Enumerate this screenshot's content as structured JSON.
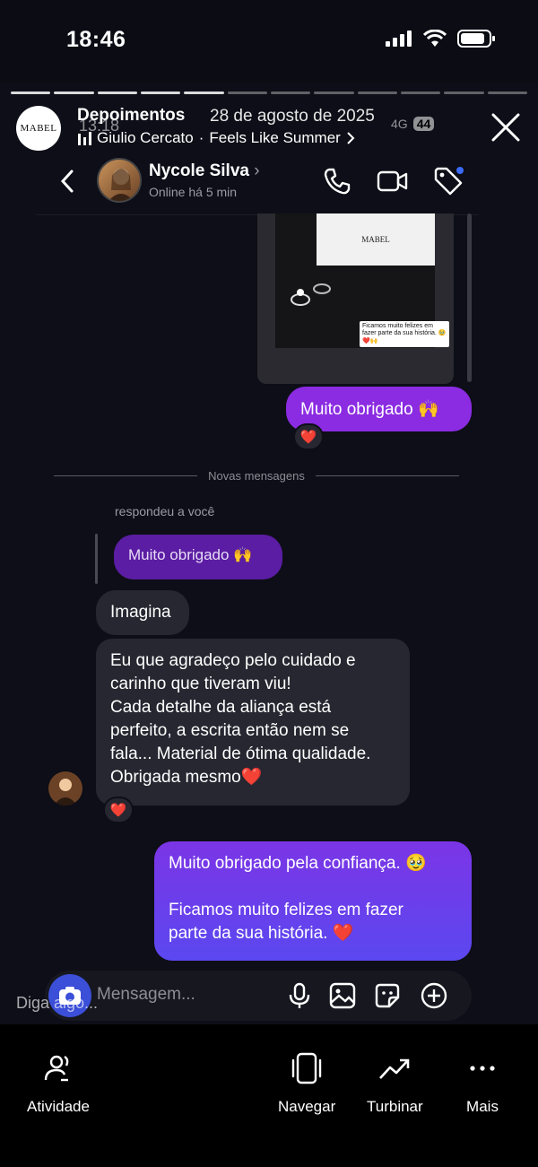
{
  "status_bar": {
    "time": "18:46"
  },
  "story": {
    "account_logo": "MABEL",
    "title": "Depoimentos",
    "date": "28 de agosto de 2025",
    "music_artist": "Giulio Cercato",
    "music_separator": "·",
    "music_track": "Feels Like Summer",
    "ghost_time": "13:18",
    "ghost_network": "4G",
    "ghost_battery": "44",
    "progress_total": 12,
    "progress_done": 5
  },
  "chat": {
    "contact_name": "Nycole Silva",
    "contact_status": "Online há 5 min",
    "photo_card_text": "MABEL",
    "photo_caption": "Ficamos muito felizes em fazer parte da sua história. 🥹❤️🙌",
    "messages": {
      "out_thanks": "Muito obrigado 🙌",
      "out_thanks_reaction": "❤️",
      "divider": "Novas mensagens",
      "replied_label": "respondeu a você",
      "quoted": "Muito obrigado 🙌",
      "in_imagina": "Imagina",
      "in_long_1": "Eu que agradeço pelo cuidado e",
      "in_long_2": "carinho que tiveram viu!",
      "in_long_3": "Cada detalhe da aliança está",
      "in_long_4": "perfeito, a escrita então nem se",
      "in_long_5": "fala... Material de ótima qualidade.",
      "in_long_6": "Obrigada mesmo❤️",
      "in_long_reaction": "❤️",
      "out_final_1": "Muito obrigado pela confiança. 🥹",
      "out_final_2": "Ficamos muito felizes em fazer",
      "out_final_3": "parte da sua história.  ❤️"
    },
    "composer": {
      "placeholder": "Mensagem...",
      "overlay": "Diga algo..."
    }
  },
  "bottom_nav": [
    {
      "label": "Atividade",
      "icon": "people-icon"
    },
    {
      "label": "Navegar",
      "icon": "phone-frame-icon"
    },
    {
      "label": "Turbinar",
      "icon": "trend-up-icon"
    },
    {
      "label": "Mais",
      "icon": "more-dots-icon"
    }
  ],
  "colors": {
    "outgoing_bubble": "#8b2be2",
    "outgoing_bubble_final": "#6a3ef0",
    "incoming_bubble": "#262730",
    "background": "#0d0e17"
  }
}
